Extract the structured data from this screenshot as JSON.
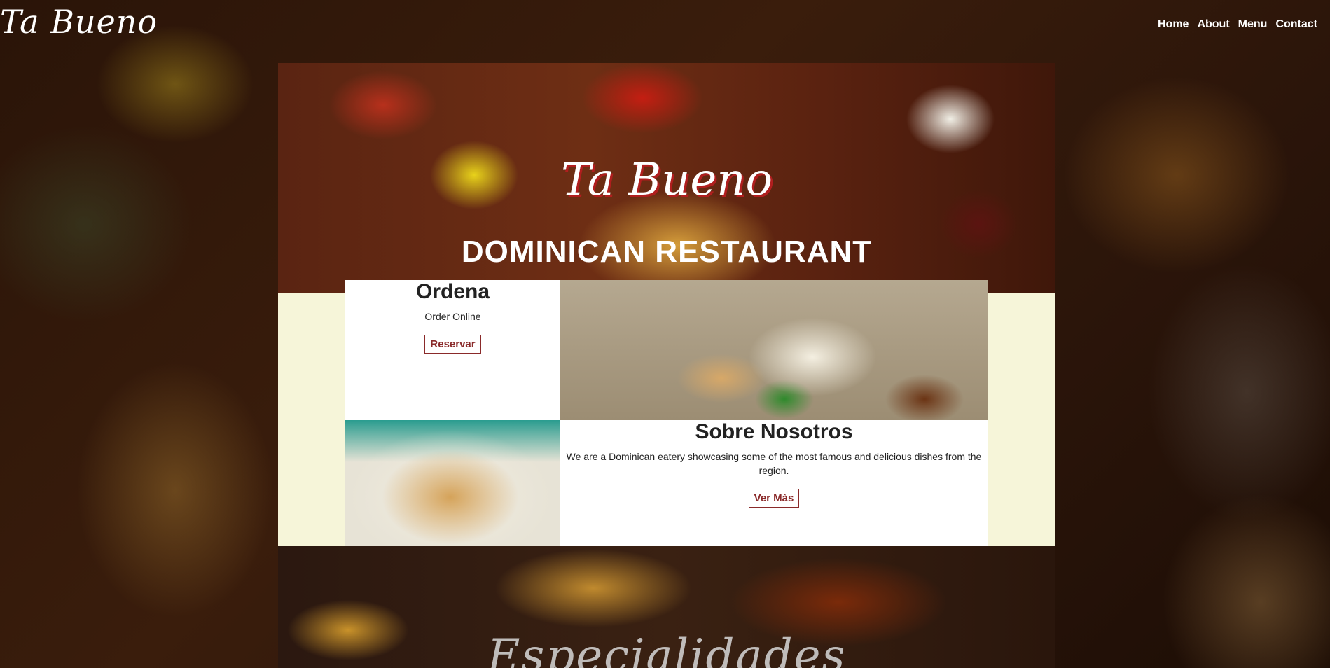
{
  "header": {
    "logo_text": "Ta Bueno",
    "nav": [
      {
        "label": "Home"
      },
      {
        "label": "About"
      },
      {
        "label": "Menu"
      },
      {
        "label": "Contact"
      }
    ]
  },
  "hero": {
    "logo_text": "Ta Bueno",
    "subtitle": "DOMINICAN RESTAURANT"
  },
  "order": {
    "title": "Ordena",
    "subtitle": "Order Online",
    "button_label": "Reservar"
  },
  "about": {
    "title": "Sobre Nosotros",
    "text": "We are a Dominican eatery showcasing some of the most famous and delicious dishes from the region.",
    "button_label": "Ver Màs"
  },
  "lower": {
    "title": "Especialidades"
  }
}
